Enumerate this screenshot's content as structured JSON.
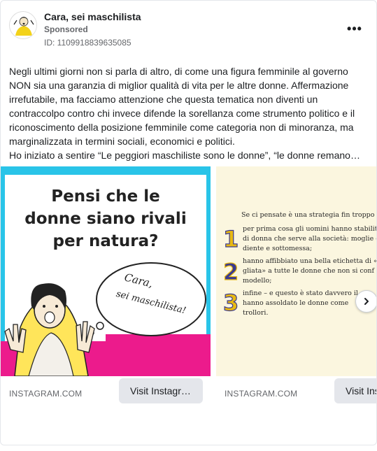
{
  "header": {
    "page_name": "Cara, sei maschilista",
    "sponsored": "Sponsored",
    "ad_id": "ID: 1109918839635085",
    "more_icon": "ellipsis-icon"
  },
  "post": {
    "paragraph": "Negli ultimi giorni non si parla di altro, di come una figura femminile al governo NON sia una garanzia di miglior qualità di vita per le altre donne. Affermazione irrefutabile, ma facciamo attenzione che questa tematica non diventi un contraccolpo contro chi invece difende la sorellanza come strumento politico e il riconoscimento della posizione femminile come categoria non di minoranza, ma marginalizzata in termini sociali, economici e politici.",
    "truncated_line": "Ho iniziato a sentire “Le peggiori maschiliste sono le donne”, “le donne remano…"
  },
  "carousel": {
    "slides": [
      {
        "title_line1": "Pensi che le",
        "title_line2": "donne siano rivali",
        "title_line3": "per natura?",
        "bubble_line1": "Cara,",
        "bubble_line2": "sei maschilista!",
        "link": "INSTAGRAM.COM",
        "cta": "Visit Instagr…"
      },
      {
        "intro": "Se ci pensate è una strategia fin troppo b",
        "item1_line1": "per prima cosa gli uomini hanno stabilito",
        "item1_line2": "di donna che serve alla società: moglie e",
        "item1_line3": "diente e sottomessa;",
        "item2_line1": "hanno affibbiato una bella etichetta di «ca",
        "item2_line2": "gliata» a tutte le donne che non si conf",
        "item2_line3": "modello;",
        "item3_line1": "infine – e questo è stato davvero il",
        "item3_line2": "hanno assoldato le donne come",
        "item3_line3": "trollori.",
        "num1": "1",
        "num2": "2",
        "num3": "3",
        "link": "INSTAGRAM.COM",
        "cta": "Visit Ins"
      }
    ],
    "next_icon": "chevron-right-icon"
  },
  "colors": {
    "cyan_frame": "#29c4e8",
    "magenta": "#ec1b8c",
    "yellow": "#f5d90a",
    "cream": "#fbf6df",
    "gold_number": "#e8b912",
    "purple_number": "#3b3a8f"
  }
}
